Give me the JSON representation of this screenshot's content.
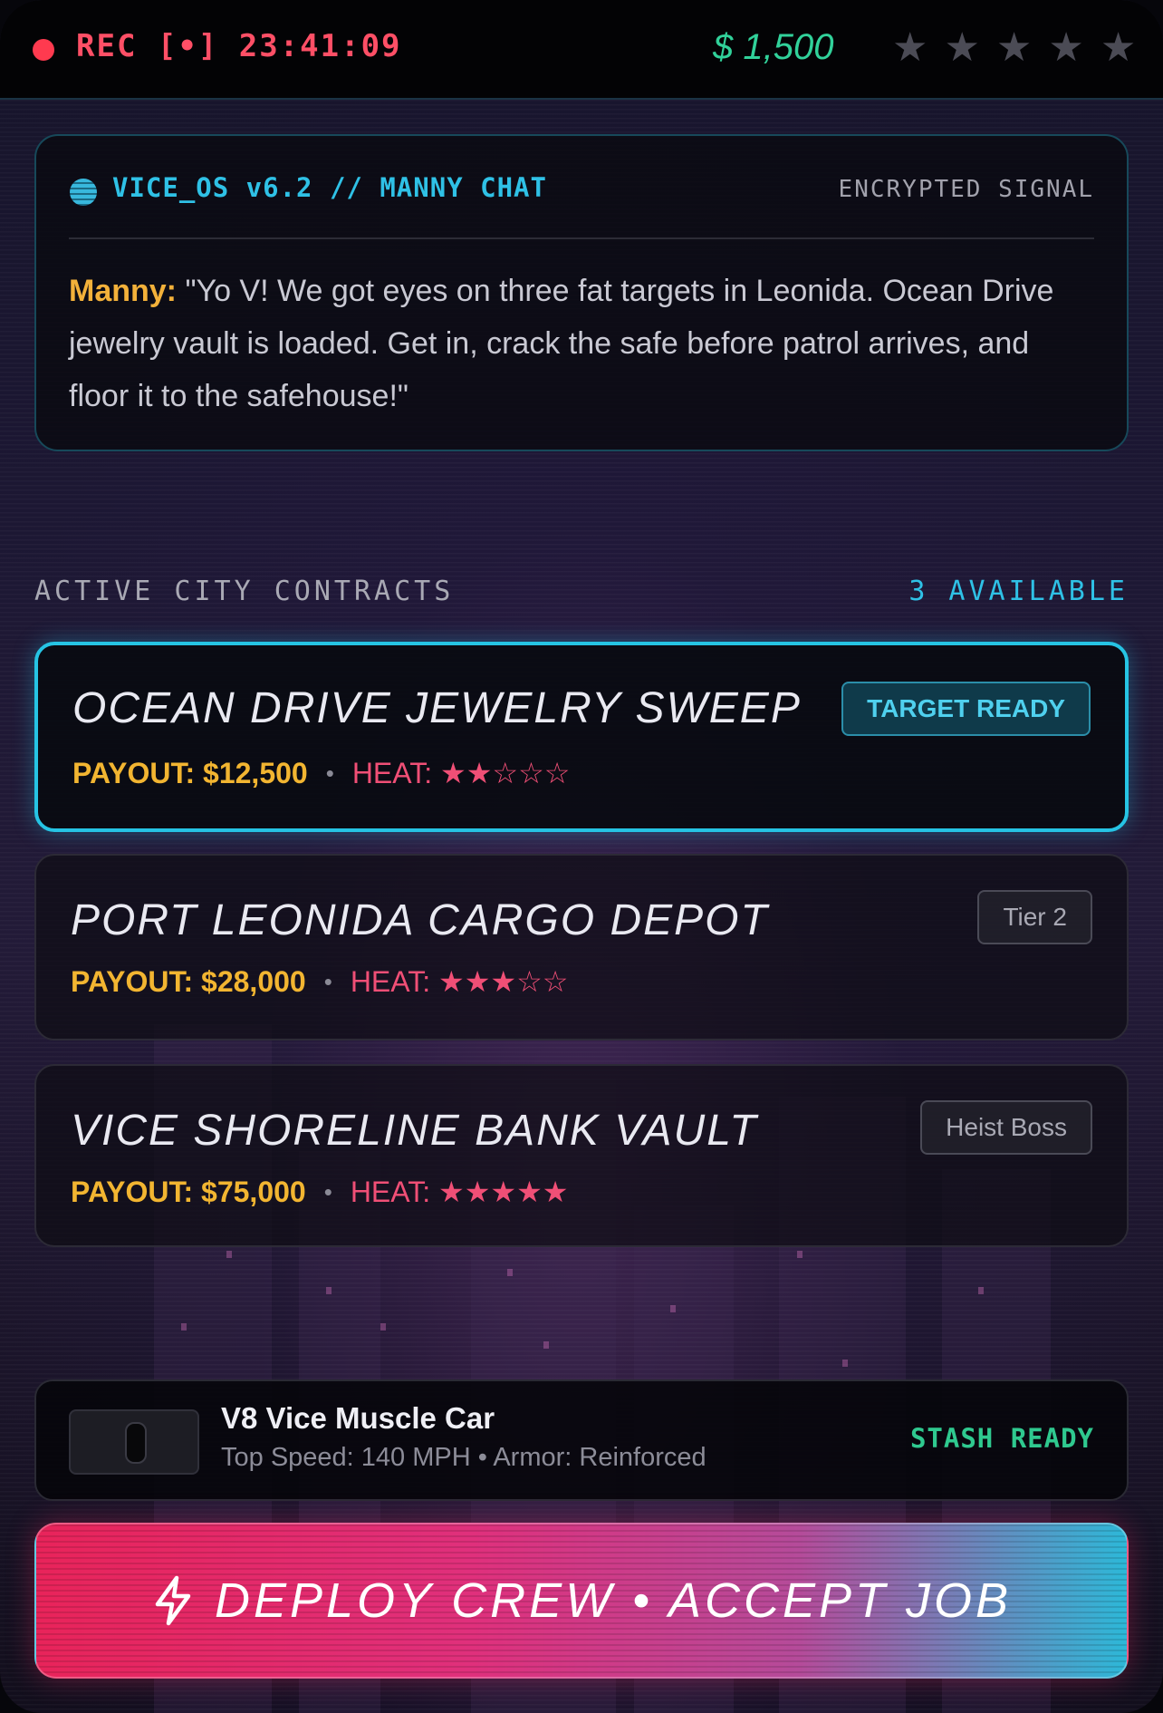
{
  "status_bar": {
    "rec_label": "REC [•] 23:41:09",
    "money": "$ 1,500",
    "wanted_stars": 5,
    "wanted_level": 0
  },
  "chat": {
    "title": "VICE_OS v6.2 // MANNY CHAT",
    "signal": "ENCRYPTED SIGNAL",
    "sender": "Manny:",
    "message": " \"Yo V! We got eyes on three fat targets in Leonida. Ocean Drive jewelry vault is loaded. Get in, crack the safe before patrol arrives, and floor it to the safehouse!\""
  },
  "contracts_section": {
    "title": "ACTIVE CITY CONTRACTS",
    "count": "3 AVAILABLE"
  },
  "contracts": [
    {
      "title": "OCEAN DRIVE JEWELRY SWEEP",
      "payout": "PAYOUT: $12,500",
      "heat": "HEAT: ★★☆☆☆",
      "badge": "TARGET READY"
    },
    {
      "title": "PORT LEONIDA CARGO DEPOT",
      "payout": "PAYOUT: $28,000",
      "heat": "HEAT: ★★★☆☆",
      "badge": "Tier 2"
    },
    {
      "title": "VICE SHORELINE BANK VAULT",
      "payout": "PAYOUT: $75,000",
      "heat": "HEAT: ★★★★★",
      "badge": "Heist Boss"
    }
  ],
  "contract_separator": "•",
  "vehicle": {
    "name": "V8 Vice Muscle Car",
    "stats": "Top Speed: 140 MPH • Armor: Reinforced",
    "status": "STASH READY"
  },
  "deploy_button": {
    "label": "DEPLOY CREW • ACCEPT JOB",
    "icon": "lightning-icon"
  },
  "colors": {
    "accent_cyan": "#2fc1e6",
    "money_green": "#31d19a",
    "rec_red": "#ff4f66",
    "payout_gold": "#f2b531",
    "heat_pink": "#f04f76"
  }
}
